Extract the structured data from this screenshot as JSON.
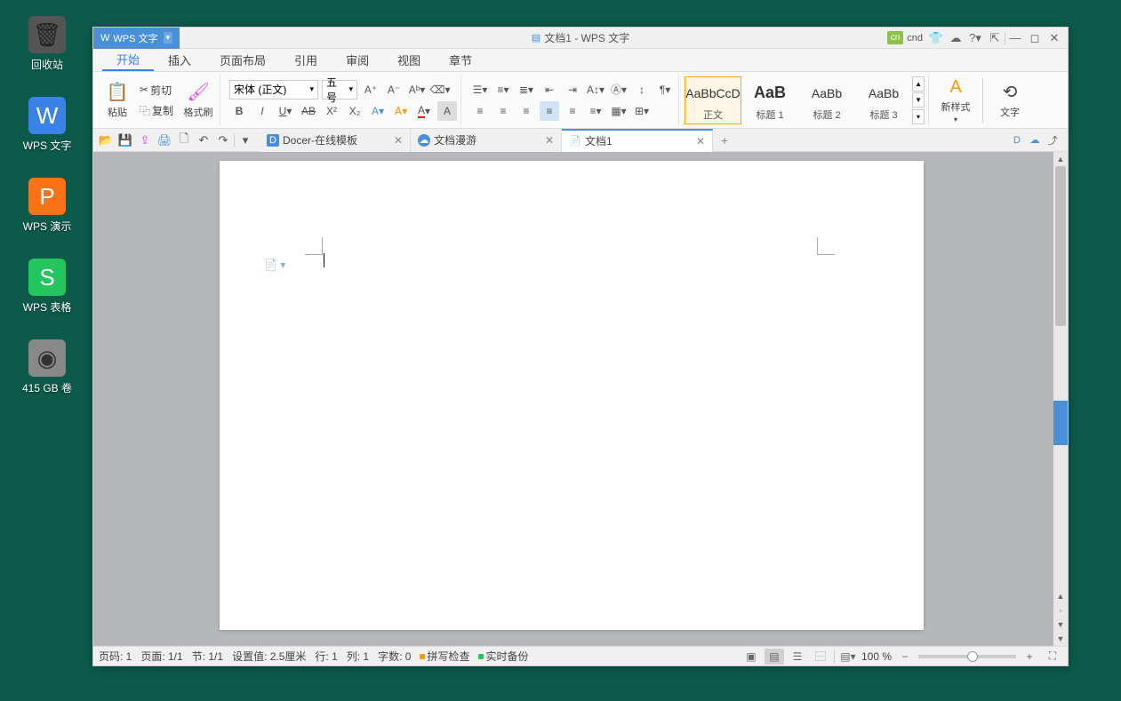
{
  "desktop": {
    "icons": [
      {
        "label": "回收站",
        "cls": "ic-trash",
        "glyph": "🗑"
      },
      {
        "label": "WPS 文字",
        "cls": "ic-wps-writer",
        "glyph": "W"
      },
      {
        "label": "WPS 演示",
        "cls": "ic-wps-present",
        "glyph": "P"
      },
      {
        "label": "WPS 表格",
        "cls": "ic-wps-sheet",
        "glyph": "S"
      },
      {
        "label": "415 GB 卷",
        "cls": "ic-disk",
        "glyph": "◉"
      }
    ]
  },
  "title_bar": {
    "app_badge": "WPS 文字",
    "window_title": "文档1 - WPS 文字",
    "right": {
      "cn_badge": "cn",
      "cnd": "cnd",
      "help": "?"
    }
  },
  "menu_tabs": [
    "开始",
    "插入",
    "页面布局",
    "引用",
    "审阅",
    "视图",
    "章节"
  ],
  "menu_active": 0,
  "ribbon": {
    "paste": "粘贴",
    "cut": "剪切",
    "copy": "复制",
    "format_painter": "格式刷",
    "font_name": "宋体 (正文)",
    "font_size": "五号",
    "styles": [
      {
        "preview": "AaBbCcD",
        "name": "正文",
        "active": true,
        "cls": ""
      },
      {
        "preview": "AaB",
        "name": "标题 1",
        "active": false,
        "cls": "h1"
      },
      {
        "preview": "AaBb",
        "name": "标题 2",
        "active": false,
        "cls": ""
      },
      {
        "preview": "AaBb",
        "name": "标题 3",
        "active": false,
        "cls": ""
      }
    ],
    "new_style": "新样式",
    "text_tool": "文字"
  },
  "doc_tabs": [
    {
      "label": "Docer-在线模板",
      "icon": "D",
      "iconcls": "docer",
      "closable": true,
      "active": false
    },
    {
      "label": "文档漫游",
      "icon": "☁",
      "iconcls": "cloud",
      "closable": true,
      "active": false
    },
    {
      "label": "文档1",
      "icon": "📄",
      "iconcls": "doc",
      "closable": true,
      "active": true
    }
  ],
  "status": {
    "page_no": "页码: 1",
    "page": "页面: 1/1",
    "section": "节: 1/1",
    "setting": "设置值: 2.5厘米",
    "line": "行: 1",
    "col": "列: 1",
    "chars": "字数: 0",
    "spellcheck": "拼写检查",
    "backup": "实时备份",
    "zoom": "100 %"
  }
}
